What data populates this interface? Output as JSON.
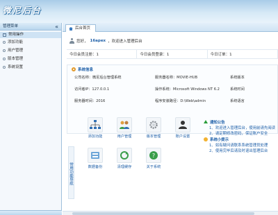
{
  "app": {
    "logo_text": "微尼后台"
  },
  "sidebar": {
    "header": "管理菜单",
    "collapse_glyph": "«",
    "active_item": "常用操作",
    "items": [
      {
        "label": "添加功能"
      },
      {
        "label": "用户管理"
      },
      {
        "label": "版本管理"
      },
      {
        "label": "系统设置"
      }
    ]
  },
  "tab": {
    "label": "后台首页"
  },
  "welcome": {
    "prefix": "您好，",
    "username": "16apex",
    "suffix": "，欢迎进入管理后台"
  },
  "stats": [
    {
      "label": "今日会员注册：1"
    },
    {
      "label": "今日会员登录：1"
    },
    {
      "label": "今日订单：1"
    }
  ],
  "server_info": {
    "title": "系统信息",
    "rows": [
      [
        "公司名称：微尼后台管理系统",
        "服务器名称：MOVIE-HUB",
        "系统版本"
      ],
      [
        "访问者IP：127.0.0.1",
        "操作系统：Microsoft Windows NT 6.2",
        "系统时间"
      ],
      [
        "服务器时间：2016",
        "程序安装路径：D:\\Web\\admin",
        "系统语言"
      ]
    ]
  },
  "quick_nav": {
    "title": "常用功能导航",
    "buttons": [
      {
        "label": "添加功能",
        "icon": "sitemap-icon"
      },
      {
        "label": "用户管理",
        "icon": "users-icon"
      },
      {
        "label": "版本管理",
        "icon": "gear-icon"
      },
      {
        "label": "账户设置",
        "icon": "user-card-icon"
      },
      {
        "label": "数据备份",
        "icon": "database-icon"
      },
      {
        "label": "清理缓存",
        "icon": "refresh-icon"
      },
      {
        "label": "关于系统",
        "icon": "help-icon"
      }
    ]
  },
  "notice": {
    "title": "通知公告",
    "lines": [
      "1、欢迎进入管理后台，使用前请先阅读",
      "2、请定期修改密码，保证账户安全"
    ],
    "tips_title": "系统小提示",
    "tips": [
      "1、如有疑问请联系系统管理员处理",
      "2、使用完毕后请及时退出管理后台"
    ]
  },
  "colors": {
    "accent": "#1e5fa8",
    "header_bg": "#a9cce8",
    "sidebar_bg": "#f4f8fc"
  }
}
